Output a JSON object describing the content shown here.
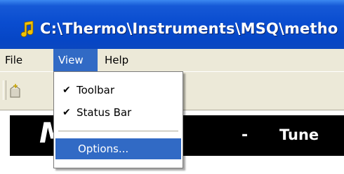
{
  "window": {
    "title": "C:\\Thermo\\Instruments\\MSQ\\metho"
  },
  "menubar": {
    "items": [
      {
        "label": "File"
      },
      {
        "label": "View"
      },
      {
        "label": "Help"
      }
    ],
    "open_menu": "View"
  },
  "view_menu": {
    "items": [
      {
        "label": "Toolbar",
        "checked": true,
        "check_glyph": "✔"
      },
      {
        "label": "Status Bar",
        "checked": true,
        "check_glyph": "✔"
      },
      {
        "label": "Options...",
        "checked": false,
        "highlighted": true
      }
    ]
  },
  "banner": {
    "letter": "M",
    "dash": "-",
    "mode": "Tune"
  },
  "icons": {
    "app": "music-note-icon",
    "toolbar_new": "new-document-icon"
  },
  "colors": {
    "titlebar": "#0a4dd0",
    "highlight": "#316ac5",
    "menubar": "#ece9d8",
    "banner": "#000000"
  }
}
